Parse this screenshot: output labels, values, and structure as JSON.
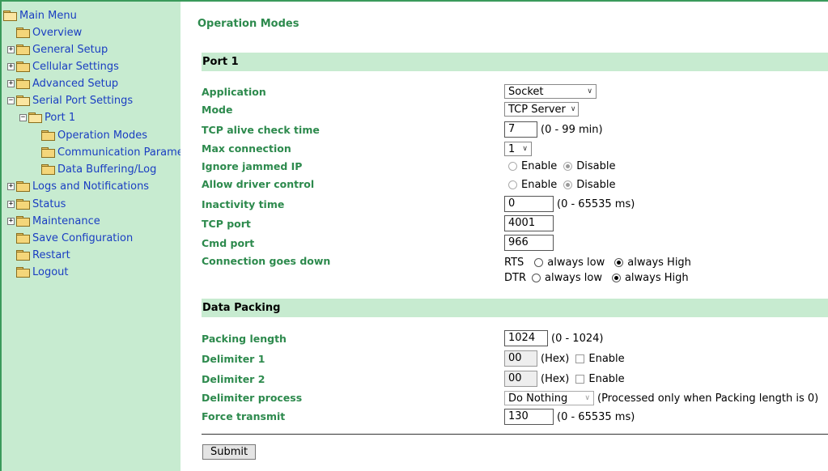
{
  "sidebar": {
    "main_menu": "Main Menu",
    "overview": "Overview",
    "general_setup": "General Setup",
    "cellular_settings": "Cellular Settings",
    "advanced_setup": "Advanced Setup",
    "serial_port_settings": "Serial Port Settings",
    "port1": "Port 1",
    "operation_modes": "Operation Modes",
    "communication_parameters": "Communication Parameters",
    "data_buffering": "Data Buffering/Log",
    "logs_notifications": "Logs and Notifications",
    "status": "Status",
    "maintenance": "Maintenance",
    "save_configuration": "Save Configuration",
    "restart": "Restart",
    "logout": "Logout",
    "expander_plus": "+",
    "expander_minus": "−"
  },
  "page": {
    "title": "Operation Modes",
    "section_port": "Port 1",
    "section_packing": "Data Packing",
    "submit": "Submit"
  },
  "fields": {
    "application": {
      "label": "Application",
      "value": "Socket"
    },
    "mode": {
      "label": "Mode",
      "value": "TCP Server"
    },
    "tcp_alive": {
      "label": "TCP alive check time",
      "value": "7",
      "hint": "(0 - 99 min)"
    },
    "max_connection": {
      "label": "Max connection",
      "value": "1"
    },
    "ignore_jammed": {
      "label": "Ignore jammed IP",
      "opt1": "Enable",
      "opt2": "Disable",
      "selected": "Disable"
    },
    "allow_driver": {
      "label": "Allow driver control",
      "opt1": "Enable",
      "opt2": "Disable",
      "selected": "Disable"
    },
    "inactivity": {
      "label": "Inactivity time",
      "value": "0",
      "hint": "(0 - 65535 ms)"
    },
    "tcp_port": {
      "label": "TCP port",
      "value": "4001"
    },
    "cmd_port": {
      "label": "Cmd port",
      "value": "966"
    },
    "conn_down": {
      "label": "Connection goes down",
      "rts": "RTS",
      "dtr": "DTR",
      "low": "always low",
      "high": "always High",
      "rts_selected": "always High",
      "dtr_selected": "always High"
    },
    "packing_length": {
      "label": "Packing length",
      "value": "1024",
      "hint": "(0 - 1024)"
    },
    "delimiter1": {
      "label": "Delimiter 1",
      "value": "00",
      "hex": "(Hex)",
      "enable": "Enable",
      "checked": false
    },
    "delimiter2": {
      "label": "Delimiter 2",
      "value": "00",
      "hex": "(Hex)",
      "enable": "Enable",
      "checked": false
    },
    "delimiter_process": {
      "label": "Delimiter process",
      "value": "Do Nothing",
      "hint": "(Processed only when Packing length is 0)"
    },
    "force_transmit": {
      "label": "Force transmit",
      "value": "130",
      "hint": "(0 - 65535 ms)"
    }
  },
  "colors": {
    "accent_green": "#2d8a4d",
    "section_bg": "#c7ebd0",
    "link_blue": "#1a3ec2"
  }
}
